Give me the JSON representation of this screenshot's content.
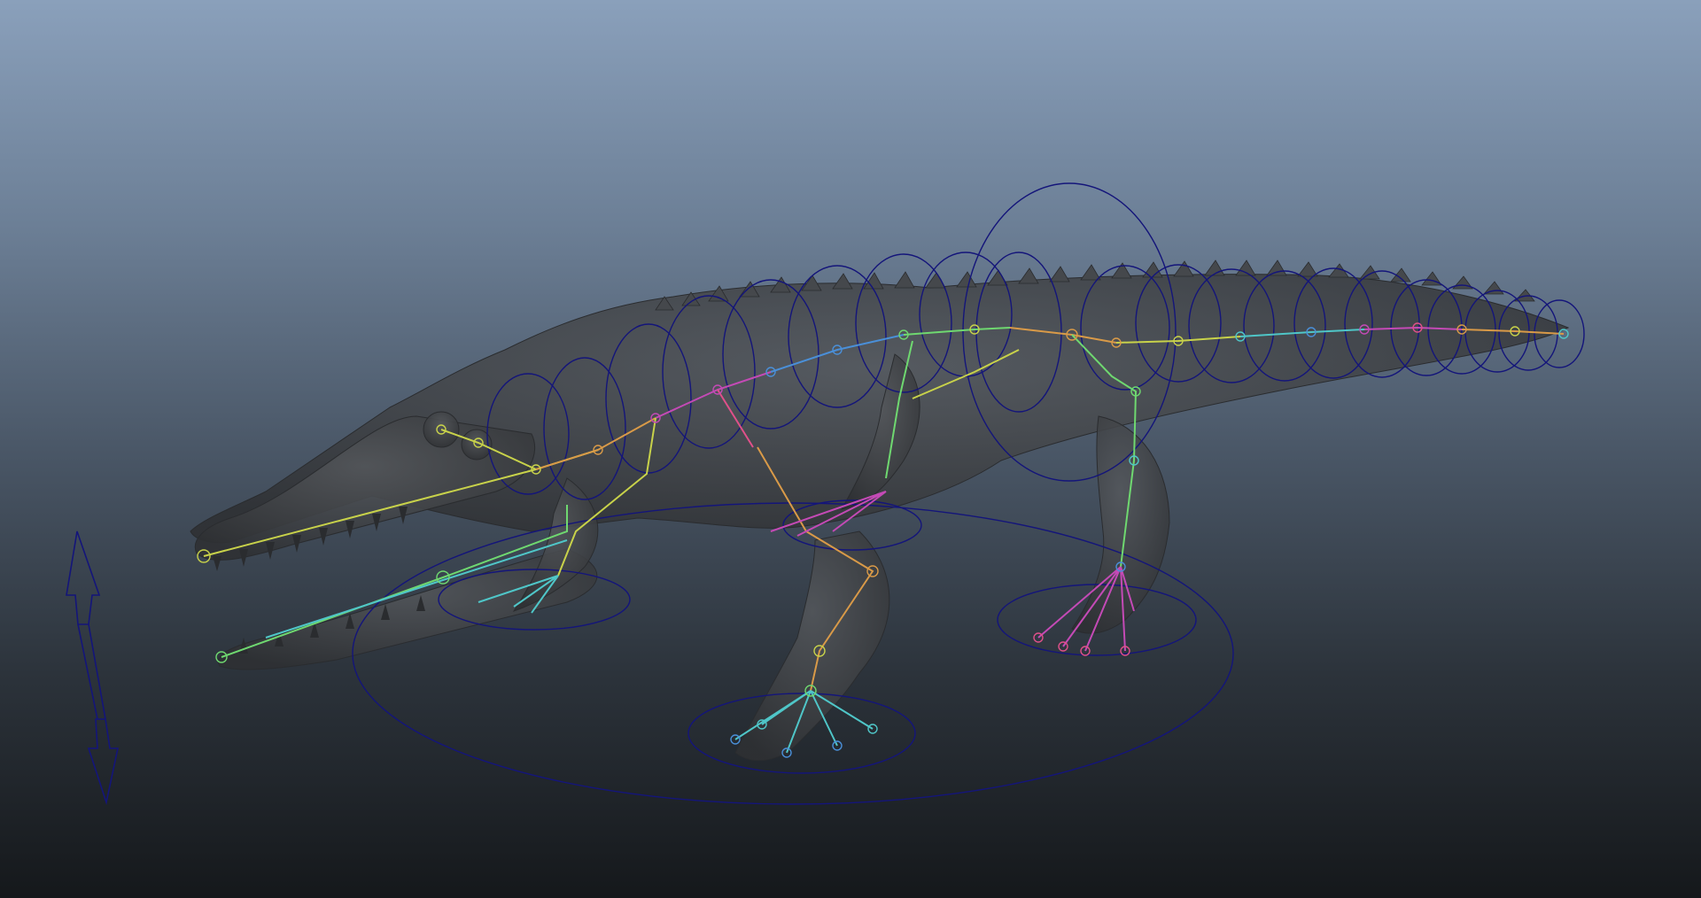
{
  "viewport": {
    "background_top": "#8aa0bb",
    "background_bottom": "#15181b"
  },
  "colors": {
    "body": "#3b3d40",
    "body_light": "#55585c",
    "control": "#14157a",
    "bone_yellow": "#c8d24a",
    "bone_green": "#6fd870",
    "bone_cyan": "#4fc6c8",
    "bone_blue": "#4a8fd8",
    "bone_magenta": "#c44ab6",
    "bone_orange": "#d99a48",
    "bone_pink": "#e0508a"
  },
  "objects": {
    "mesh": "crocodile-mesh",
    "skeleton": "joint-hierarchy",
    "controls": "nurbs-circle-controls",
    "manipulator": "double-arrow-manipulator"
  }
}
